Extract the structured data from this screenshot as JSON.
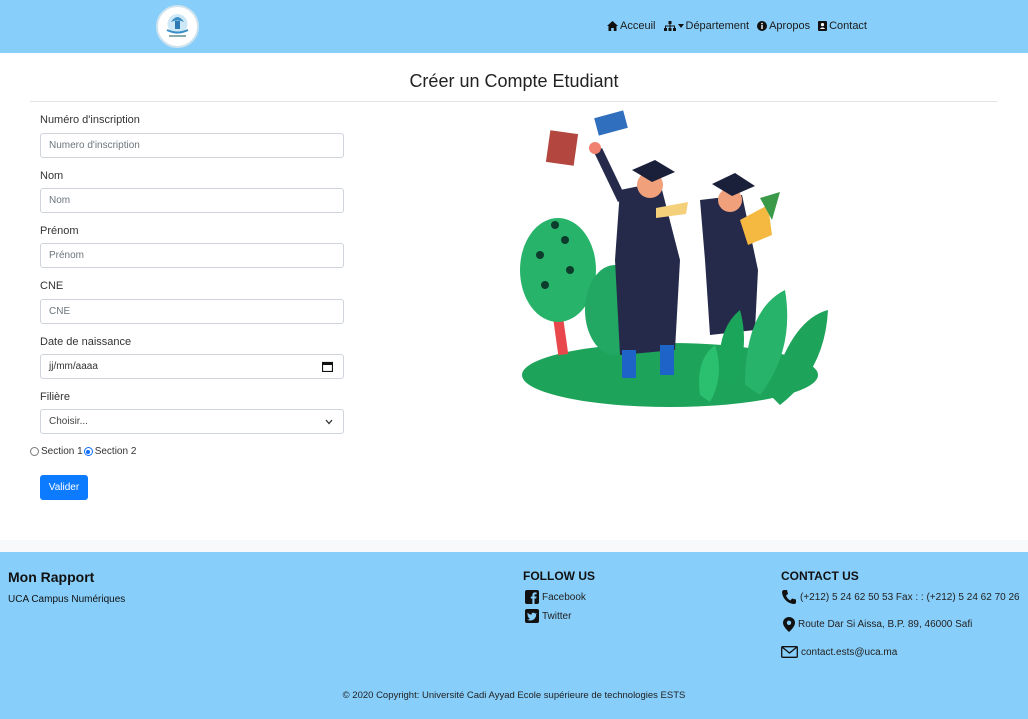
{
  "nav": {
    "items": [
      {
        "label": "Acceuil",
        "icon": "home-icon"
      },
      {
        "label": "Département",
        "icon": "sitemap-icon"
      },
      {
        "label": "Apropos",
        "icon": "info-icon"
      },
      {
        "label": "Contact",
        "icon": "contact-card-icon"
      }
    ]
  },
  "page": {
    "title": "Créer un Compte Etudiant"
  },
  "form": {
    "numero": {
      "label": "Numéro d'inscription",
      "placeholder": "Numero d'inscription"
    },
    "nom": {
      "label": "Nom",
      "placeholder": "Nom"
    },
    "prenom": {
      "label": "Prénom",
      "placeholder": "Prénom"
    },
    "cne": {
      "label": "CNE",
      "placeholder": "CNE"
    },
    "date": {
      "label": "Date de naissance",
      "value": "jj/mm/aaaa"
    },
    "filiere": {
      "label": "Filière",
      "value": "Choisir..."
    },
    "sections": [
      {
        "label": "Section 1",
        "checked": false
      },
      {
        "label": "Section 2",
        "checked": true
      }
    ],
    "submit": "Valider"
  },
  "footer": {
    "brand": "Mon Rapport",
    "brand_sub": "UCA Campus Numériques",
    "follow_title": "FOLLOW US",
    "facebook": "Facebook",
    "twitter": "Twitter",
    "contact_title": "CONTACT US",
    "phone": "(+212) 5 24 62 50 53 Fax : : (+212) 5 24 62 70 26",
    "address": "Route Dar Si Aissa, B.P. 89, 46000 Safi",
    "email": "contact.ests@uca.ma",
    "copyright": "© 2020 Copyright: Université Cadi Ayyad Ecole supérieure de technologies ESTS"
  },
  "colors": {
    "navbar": "#87cefa",
    "footer": "#87cefa",
    "button": "#0d7bff"
  }
}
